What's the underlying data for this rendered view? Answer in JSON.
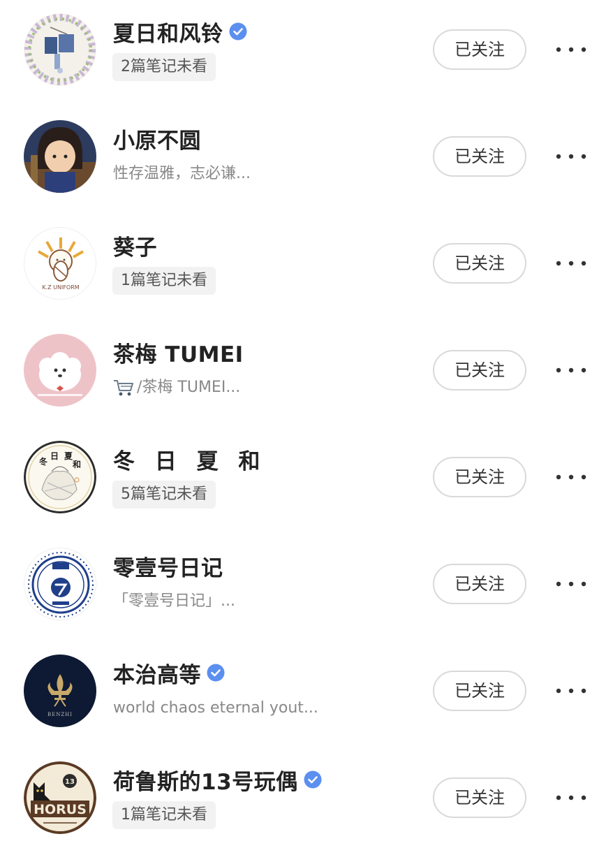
{
  "colors": {
    "verified": "#5b8ff0",
    "badge_bg": "#f2f2f2",
    "button_border": "#d9d9d9",
    "bio_text": "#888888"
  },
  "follow_label": "已关注",
  "users": [
    {
      "name": "夏日和风铃",
      "verified": true,
      "badge": "2篇笔记未看",
      "bio": null,
      "avatar_icon": "wind-chime-avatar"
    },
    {
      "name": "小原不圆",
      "verified": false,
      "badge": null,
      "bio": "性存温雅，志必谦...",
      "avatar_icon": "girl-portrait-avatar"
    },
    {
      "name": "葵子",
      "verified": false,
      "badge": "1篇笔记未看",
      "bio": null,
      "avatar_icon": "k-z-uniform-logo-avatar",
      "avatar_text": "K.Z UNIFORM"
    },
    {
      "name": "茶梅 TUMEI",
      "verified": false,
      "badge": null,
      "bio": "/茶梅 TUMEI...",
      "bio_icon": "shopping-cart-icon",
      "avatar_icon": "fluffy-dog-avatar"
    },
    {
      "name": "冬 日 夏 和",
      "verified": false,
      "badge": "5篇笔记未看",
      "bio": null,
      "avatar_icon": "sketch-girl-avatar",
      "avatar_text": [
        "冬",
        "日",
        "夏",
        "和"
      ]
    },
    {
      "name": "零壹号日记",
      "verified": false,
      "badge": null,
      "bio": "「零壹号日记」...",
      "avatar_icon": "emblem-logo-avatar"
    },
    {
      "name": "本治高等",
      "verified": true,
      "badge": null,
      "bio": "world chaos eternal yout...",
      "avatar_icon": "fleur-de-lis-avatar",
      "avatar_text": "BENZHI"
    },
    {
      "name": "荷鲁斯的13号玩偶",
      "verified": true,
      "badge": "1篇笔记未看",
      "bio": null,
      "avatar_icon": "horus-cat-avatar",
      "avatar_text": [
        "13",
        "HORUS"
      ]
    }
  ]
}
